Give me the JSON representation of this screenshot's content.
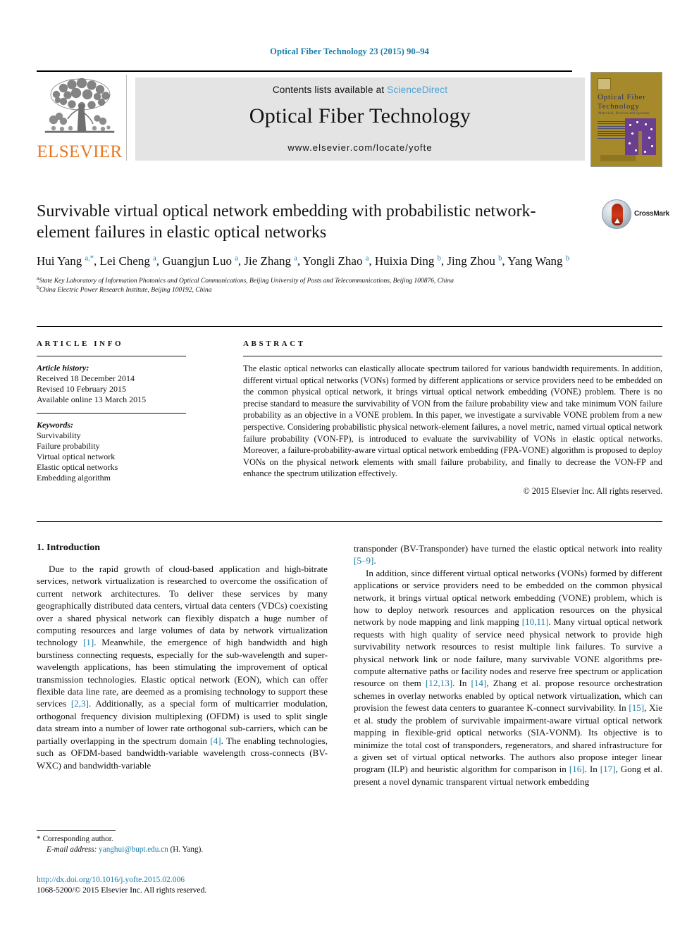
{
  "running_head": "Optical Fiber Technology 23 (2015) 90–94",
  "masthead": {
    "contents_prefix": "Contents lists available at ",
    "sciencedirect": "ScienceDirect",
    "journal_title": "Optical Fiber Technology",
    "journal_url": "www.elsevier.com/locate/yofte",
    "publisher": "ELSEVIER",
    "cover": {
      "line1": "Optical Fiber",
      "line2": "Technology",
      "subtitle": "Materials, Devices and Systems"
    }
  },
  "article": {
    "title": "Survivable virtual optical network embedding with probabilistic network-element failures in elastic optical networks",
    "crossmark_label": "CrossMark",
    "authors_html": "Hui Yang <sup>a,*</sup>, Lei Cheng <sup>a</sup>, Guangjun Luo <sup>a</sup>, Jie Zhang <sup>a</sup>, Yongli Zhao <sup>a</sup>, Huixia Ding <sup>b</sup>, Jing Zhou <sup>b</sup>, Yang Wang <sup>b</sup>",
    "affiliation_a": "State Key Laboratory of Information Photonics and Optical Communications, Beijing University of Posts and Telecommunications, Beijing 100876, China",
    "affiliation_b": "China Electric Power Research Institute, Beijing 100192, China"
  },
  "info": {
    "heading": "ARTICLE INFO",
    "history_label": "Article history:",
    "history": [
      "Received 18 December 2014",
      "Revised 10 February 2015",
      "Available online 13 March 2015"
    ],
    "keywords_label": "Keywords:",
    "keywords": [
      "Survivability",
      "Failure probability",
      "Virtual optical network",
      "Elastic optical networks",
      "Embedding algorithm"
    ]
  },
  "abstract": {
    "heading": "ABSTRACT",
    "text": "The elastic optical networks can elastically allocate spectrum tailored for various bandwidth requirements. In addition, different virtual optical networks (VONs) formed by different applications or service providers need to be embedded on the common physical optical network, it brings virtual optical network embedding (VONE) problem. There is no precise standard to measure the survivability of VON from the failure probability view and take minimum VON failure probability as an objective in a VONE problem. In this paper, we investigate a survivable VONE problem from a new perspective. Considering probabilistic physical network-element failures, a novel metric, named virtual optical network failure probability (VON-FP), is introduced to evaluate the survivability of VONs in elastic optical networks. Moreover, a failure-probability-aware virtual optical network embedding (FPA-VONE) algorithm is proposed to deploy VONs on the physical network elements with small failure probability, and finally to decrease the VON-FP and enhance the spectrum utilization effectively.",
    "copyright": "© 2015 Elsevier Inc. All rights reserved."
  },
  "body": {
    "section_title": "1. Introduction",
    "left_paragraph_html": "Due to the rapid growth of cloud-based application and high-bitrate services, network virtualization is researched to overcome the ossification of current network architectures. To deliver these services by many geographically distributed data centers, virtual data centers (VDCs) coexisting over a shared physical network can flexibly dispatch a huge number of computing resources and large volumes of data by network virtualization technology <span class=\"ref\">[1]</span>. Meanwhile, the emergence of high bandwidth and high burstiness connecting requests, especially for the sub-wavelength and super-wavelength applications, has been stimulating the improvement of optical transmission technologies. Elastic optical network (EON), which can offer flexible data line rate, are deemed as a promising technology to support these services <span class=\"ref\">[2,3]</span>. Additionally, as a special form of multicarrier modulation, orthogonal frequency division multiplexing (OFDM) is used to split single data stream into a number of lower rate orthogonal sub-carriers, which can be partially overlapping in the spectrum domain <span class=\"ref\">[4]</span>. The enabling technologies, such as OFDM-based bandwidth-variable wavelength cross-connects (BV-WXC) and bandwidth-variable",
    "right_paragraph_1_html": "transponder (BV-Transponder) have turned the elastic optical network into reality <span class=\"ref\">[5–9]</span>.",
    "right_paragraph_2_html": "In addition, since different virtual optical networks (VONs) formed by different applications or service providers need to be embedded on the common physical network, it brings virtual optical network embedding (VONE) problem, which is how to deploy network resources and application resources on the physical network by node mapping and link mapping <span class=\"ref\">[10,11]</span>. Many virtual optical network requests with high quality of service need physical network to provide high survivability network resources to resist multiple link failures. To survive a physical network link or node failure, many survivable VONE algorithms pre-compute alternative paths or facility nodes and reserve free spectrum or application resource on them <span class=\"ref\">[12,13]</span>. In <span class=\"ref\">[14]</span>, Zhang et al. propose resource orchestration schemes in overlay networks enabled by optical network virtualization, which can provision the fewest data centers to guarantee K-connect survivability. In <span class=\"ref\">[15]</span>, Xie et al. study the problem of survivable impairment-aware virtual optical network mapping in flexible-grid optical networks (SIA-VONM). Its objective is to minimize the total cost of transponders, regenerators, and shared infrastructure for a given set of virtual optical networks. The authors also propose integer linear program (ILP) and heuristic algorithm for comparison in <span class=\"ref\">[16]</span>. In <span class=\"ref\">[17]</span>, Gong et al. present a novel dynamic transparent virtual network embedding"
  },
  "footer": {
    "corresponding": "Corresponding author.",
    "email_label": "E-mail address:",
    "email": "yanghui@bupt.edu.cn",
    "email_owner": "(H. Yang).",
    "doi": "http://dx.doi.org/10.1016/j.yofte.2015.02.006",
    "issn_line": "1068-5200/© 2015 Elsevier Inc. All rights reserved."
  },
  "colors": {
    "link": "#1a7ba8",
    "sciencedirect": "#4aa3d6",
    "elsevier_orange": "#e87722",
    "band": "#e4e4e4"
  }
}
